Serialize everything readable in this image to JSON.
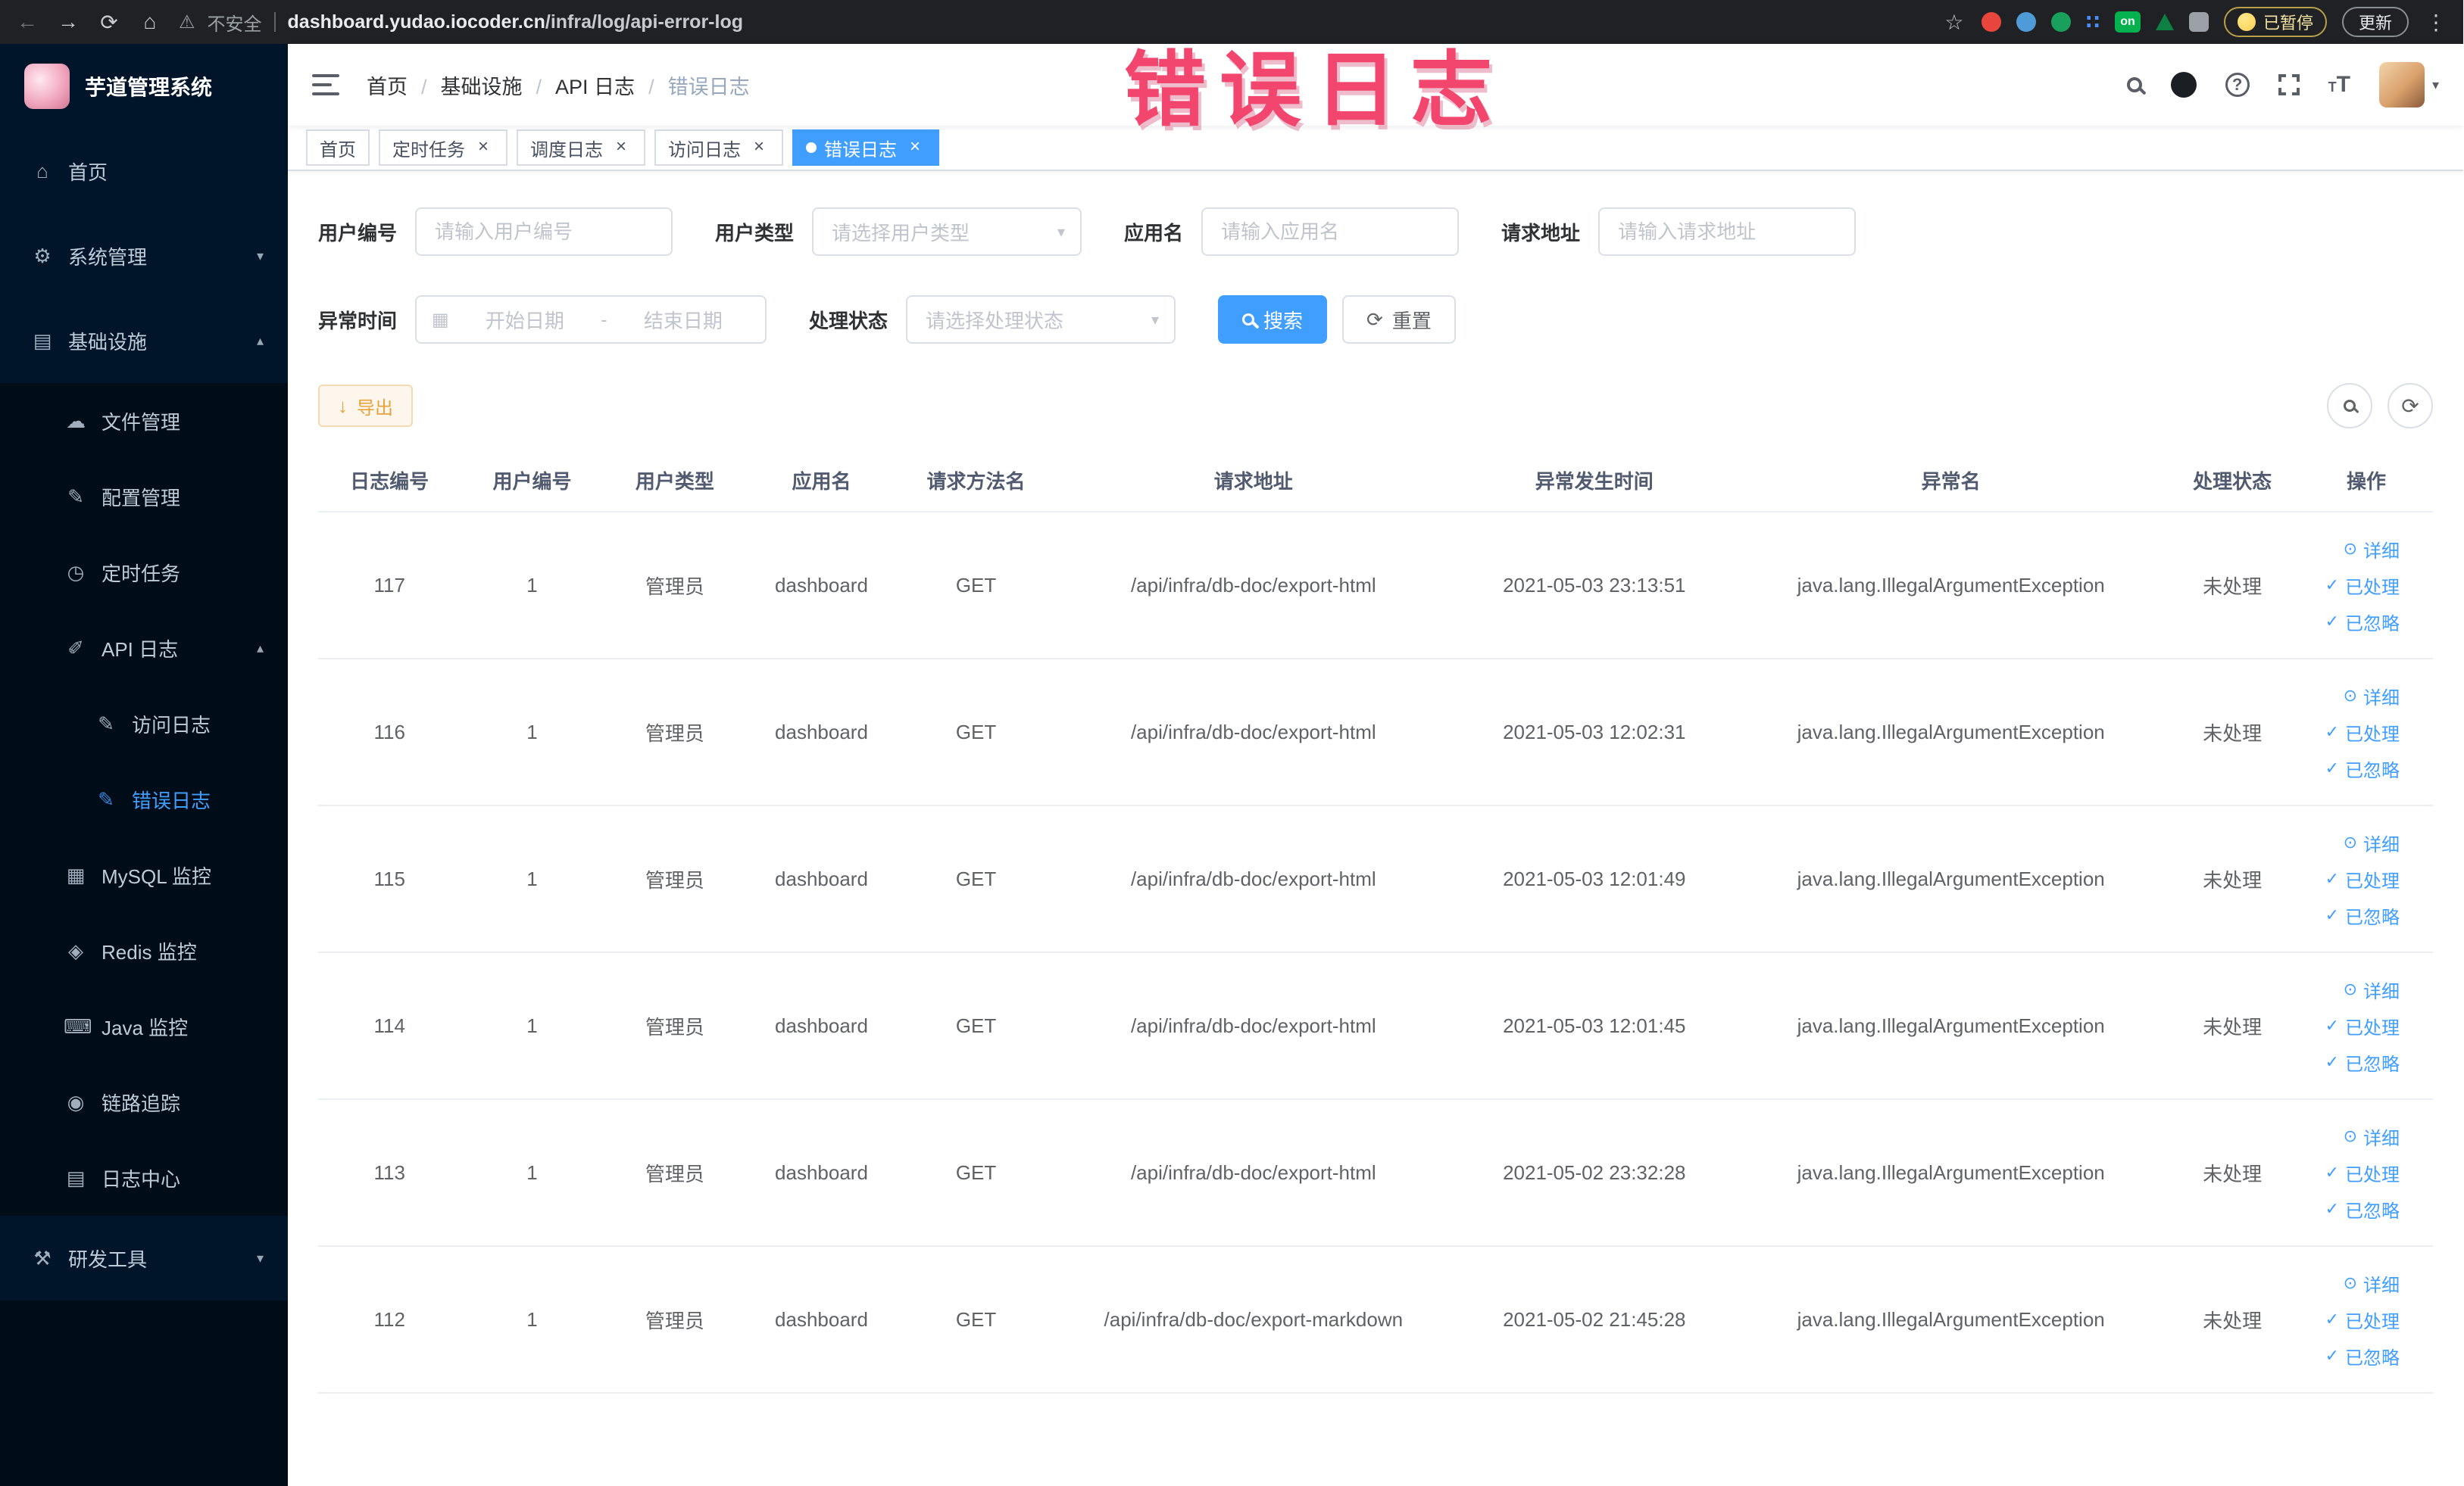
{
  "annotation": {
    "text": "错误日志"
  },
  "browser": {
    "icons": {
      "back": "←",
      "forward": "→",
      "reload": "⟳",
      "home": "⌂",
      "warning": "⚠",
      "star": "☆",
      "grid": "∷",
      "menu": "⋮"
    },
    "security_warning": "不安全",
    "url_domain": "dashboard.yudao.iocoder.cn",
    "url_path": "/infra/log/api-error-log",
    "ext_on_label": "on",
    "paused_label": "已暂停",
    "update_label": "更新"
  },
  "sidebar": {
    "app_title": "芋道管理系统",
    "items": [
      {
        "name": "home",
        "label": "首页",
        "icon": "home-icon",
        "glyph": "⌂",
        "level": 1
      },
      {
        "name": "system-management",
        "label": "系统管理",
        "icon": "gear-icon",
        "glyph": "⚙",
        "level": 1,
        "chevron": "down"
      },
      {
        "name": "infrastructure",
        "label": "基础设施",
        "icon": "grid-icon",
        "glyph": "▤",
        "level": 1,
        "chevron": "up"
      },
      {
        "name": "file-management",
        "label": "文件管理",
        "icon": "cloud-icon",
        "glyph": "☁",
        "level": 2,
        "dark": true
      },
      {
        "name": "config-management",
        "label": "配置管理",
        "icon": "edit-icon",
        "glyph": "✎",
        "level": 2,
        "dark": true
      },
      {
        "name": "scheduled-tasks",
        "label": "定时任务",
        "icon": "timer-icon",
        "glyph": "◷",
        "level": 2,
        "dark": true
      },
      {
        "name": "api-log",
        "label": "API 日志",
        "icon": "log-icon",
        "glyph": "✐",
        "level": 2,
        "dark": true,
        "chevron": "up"
      },
      {
        "name": "access-log",
        "label": "访问日志",
        "icon": "doc-icon",
        "glyph": "✎",
        "level": 3,
        "dark": true
      },
      {
        "name": "error-log",
        "label": "错误日志",
        "icon": "doc-icon",
        "glyph": "✎",
        "level": 3,
        "dark": true,
        "active": true
      },
      {
        "name": "mysql-monitor",
        "label": "MySQL 监控",
        "icon": "database-icon",
        "glyph": "▦",
        "level": 2,
        "dark": true
      },
      {
        "name": "redis-monitor",
        "label": "Redis 监控",
        "icon": "cube-icon",
        "glyph": "◈",
        "level": 2,
        "dark": true
      },
      {
        "name": "java-monitor",
        "label": "Java 监控",
        "icon": "monitor-icon",
        "glyph": "⌨",
        "level": 2,
        "dark": true
      },
      {
        "name": "trace",
        "label": "链路追踪",
        "icon": "eye-icon",
        "glyph": "◉",
        "level": 2,
        "dark": true
      },
      {
        "name": "log-center",
        "label": "日志中心",
        "icon": "list-icon",
        "glyph": "▤",
        "level": 2,
        "dark": true
      },
      {
        "name": "dev-tools",
        "label": "研发工具",
        "icon": "tools-icon",
        "glyph": "⚒",
        "level": 1,
        "chevron": "down"
      }
    ]
  },
  "header": {
    "breadcrumb": [
      "首页",
      "基础设施",
      "API 日志",
      "错误日志"
    ],
    "icons": {
      "question": "?",
      "font_size_large": "T",
      "font_size_small": "T",
      "avatar_caret": "▾"
    }
  },
  "tabs": [
    {
      "label": "首页"
    },
    {
      "label": "定时任务"
    },
    {
      "label": "调度日志"
    },
    {
      "label": "访问日志"
    },
    {
      "label": "错误日志"
    }
  ],
  "filters": {
    "user_id": {
      "label": "用户编号",
      "placeholder": "请输入用户编号"
    },
    "user_type": {
      "label": "用户类型",
      "placeholder": "请选择用户类型"
    },
    "app_name": {
      "label": "应用名",
      "placeholder": "请输入应用名"
    },
    "request_url": {
      "label": "请求地址",
      "placeholder": "请输入请求地址"
    },
    "exception_time": {
      "label": "异常时间",
      "start_placeholder": "开始日期",
      "end_placeholder": "结束日期",
      "separator": "-",
      "calendar_glyph": "▦"
    },
    "process_status": {
      "label": "处理状态",
      "placeholder": "请选择处理状态"
    },
    "search_button": "搜索",
    "reset_button": "重置",
    "reset_glyph": "⟳"
  },
  "toolbar": {
    "export_button": "导出",
    "export_glyph": "↓",
    "refresh_glyph": "⟳"
  },
  "table": {
    "columns": [
      "日志编号",
      "用户编号",
      "用户类型",
      "应用名",
      "请求方法名",
      "请求地址",
      "异常发生时间",
      "异常名",
      "处理状态",
      "操作"
    ],
    "actions": [
      "详细",
      "已处理",
      "已忽略"
    ],
    "action_icons": [
      "⊙",
      "✓",
      "✓"
    ],
    "rows": [
      {
        "id": "117",
        "user_id": "1",
        "user_type": "管理员",
        "app": "dashboard",
        "method": "GET",
        "url": "/api/infra/db-doc/export-html",
        "time": "2021-05-03 23:13:51",
        "exception": "java.lang.IllegalArgumentException",
        "status": "未处理"
      },
      {
        "id": "116",
        "user_id": "1",
        "user_type": "管理员",
        "app": "dashboard",
        "method": "GET",
        "url": "/api/infra/db-doc/export-html",
        "time": "2021-05-03 12:02:31",
        "exception": "java.lang.IllegalArgumentException",
        "status": "未处理"
      },
      {
        "id": "115",
        "user_id": "1",
        "user_type": "管理员",
        "app": "dashboard",
        "method": "GET",
        "url": "/api/infra/db-doc/export-html",
        "time": "2021-05-03 12:01:49",
        "exception": "java.lang.IllegalArgumentException",
        "status": "未处理"
      },
      {
        "id": "114",
        "user_id": "1",
        "user_type": "管理员",
        "app": "dashboard",
        "method": "GET",
        "url": "/api/infra/db-doc/export-html",
        "time": "2021-05-03 12:01:45",
        "exception": "java.lang.IllegalArgumentException",
        "status": "未处理"
      },
      {
        "id": "113",
        "user_id": "1",
        "user_type": "管理员",
        "app": "dashboard",
        "method": "GET",
        "url": "/api/infra/db-doc/export-html",
        "time": "2021-05-02 23:32:28",
        "exception": "java.lang.IllegalArgumentException",
        "status": "未处理"
      },
      {
        "id": "112",
        "user_id": "1",
        "user_type": "管理员",
        "app": "dashboard",
        "method": "GET",
        "url": "/api/infra/db-doc/export-markdown",
        "time": "2021-05-02 21:45:28",
        "exception": "java.lang.IllegalArgumentException",
        "status": "未处理"
      }
    ]
  },
  "colors": {
    "accent": "#409EFF",
    "sidebar_bg": "#001529",
    "submenu_bg": "#000c17",
    "warning_button": "#e6a23c",
    "annotation_pink": "#f2466e"
  }
}
